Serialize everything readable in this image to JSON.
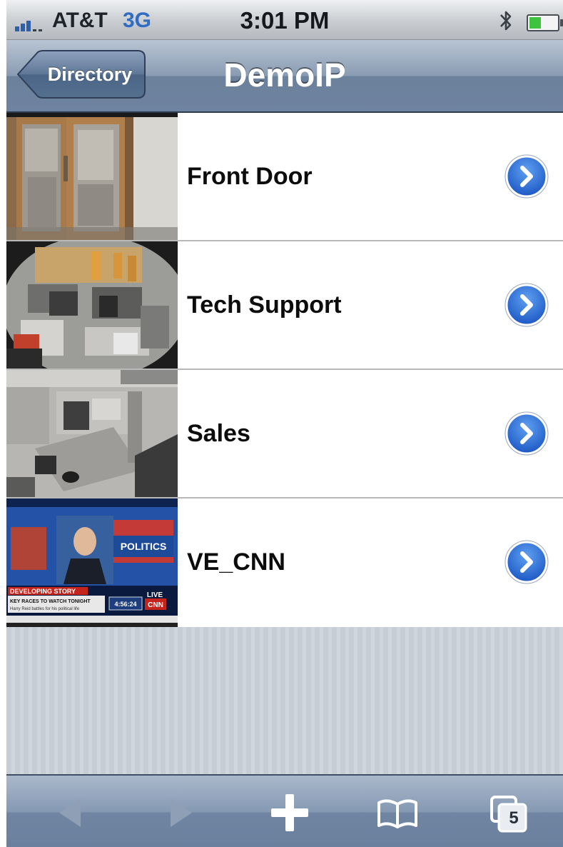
{
  "status_bar": {
    "carrier": "AT&T",
    "network": "3G",
    "time": "3:01 PM",
    "icons": [
      "signal-icon",
      "bluetooth-icon",
      "battery-icon"
    ]
  },
  "nav_bar": {
    "back_label": "Directory",
    "title": "DemoIP"
  },
  "cameras": [
    {
      "label": "Front Door",
      "thumbnail": "front-door-camera-thumbnail",
      "action_icon": "chevron-right-circle-icon"
    },
    {
      "label": "Tech Support",
      "thumbnail": "tech-support-camera-thumbnail",
      "action_icon": "chevron-right-circle-icon"
    },
    {
      "label": "Sales",
      "thumbnail": "sales-camera-thumbnail",
      "action_icon": "chevron-right-circle-icon"
    },
    {
      "label": "VE_CNN",
      "thumbnail": "cnn-camera-thumbnail",
      "action_icon": "chevron-right-circle-icon"
    }
  ],
  "thumbnail_overlay_text": {
    "cnn_banner": "DEVELOPING STORY",
    "cnn_headline": "KEY RACES TO WATCH TONIGHT",
    "cnn_subline": "Harry Reid battles for his political life",
    "cnn_clock": "4:56:24",
    "cnn_live": "LIVE",
    "cnn_logo": "CNN",
    "cnn_politics": "POLITICS"
  },
  "toolbar": {
    "items": [
      "back-arrow-icon",
      "forward-arrow-icon",
      "add-icon",
      "bookmarks-icon",
      "pages-icon"
    ],
    "tab_count": "5"
  },
  "colors": {
    "nav_bar": "#7a8eaa",
    "disclosure_blue": "#2e6fd8",
    "background": "#c6cdd5"
  }
}
